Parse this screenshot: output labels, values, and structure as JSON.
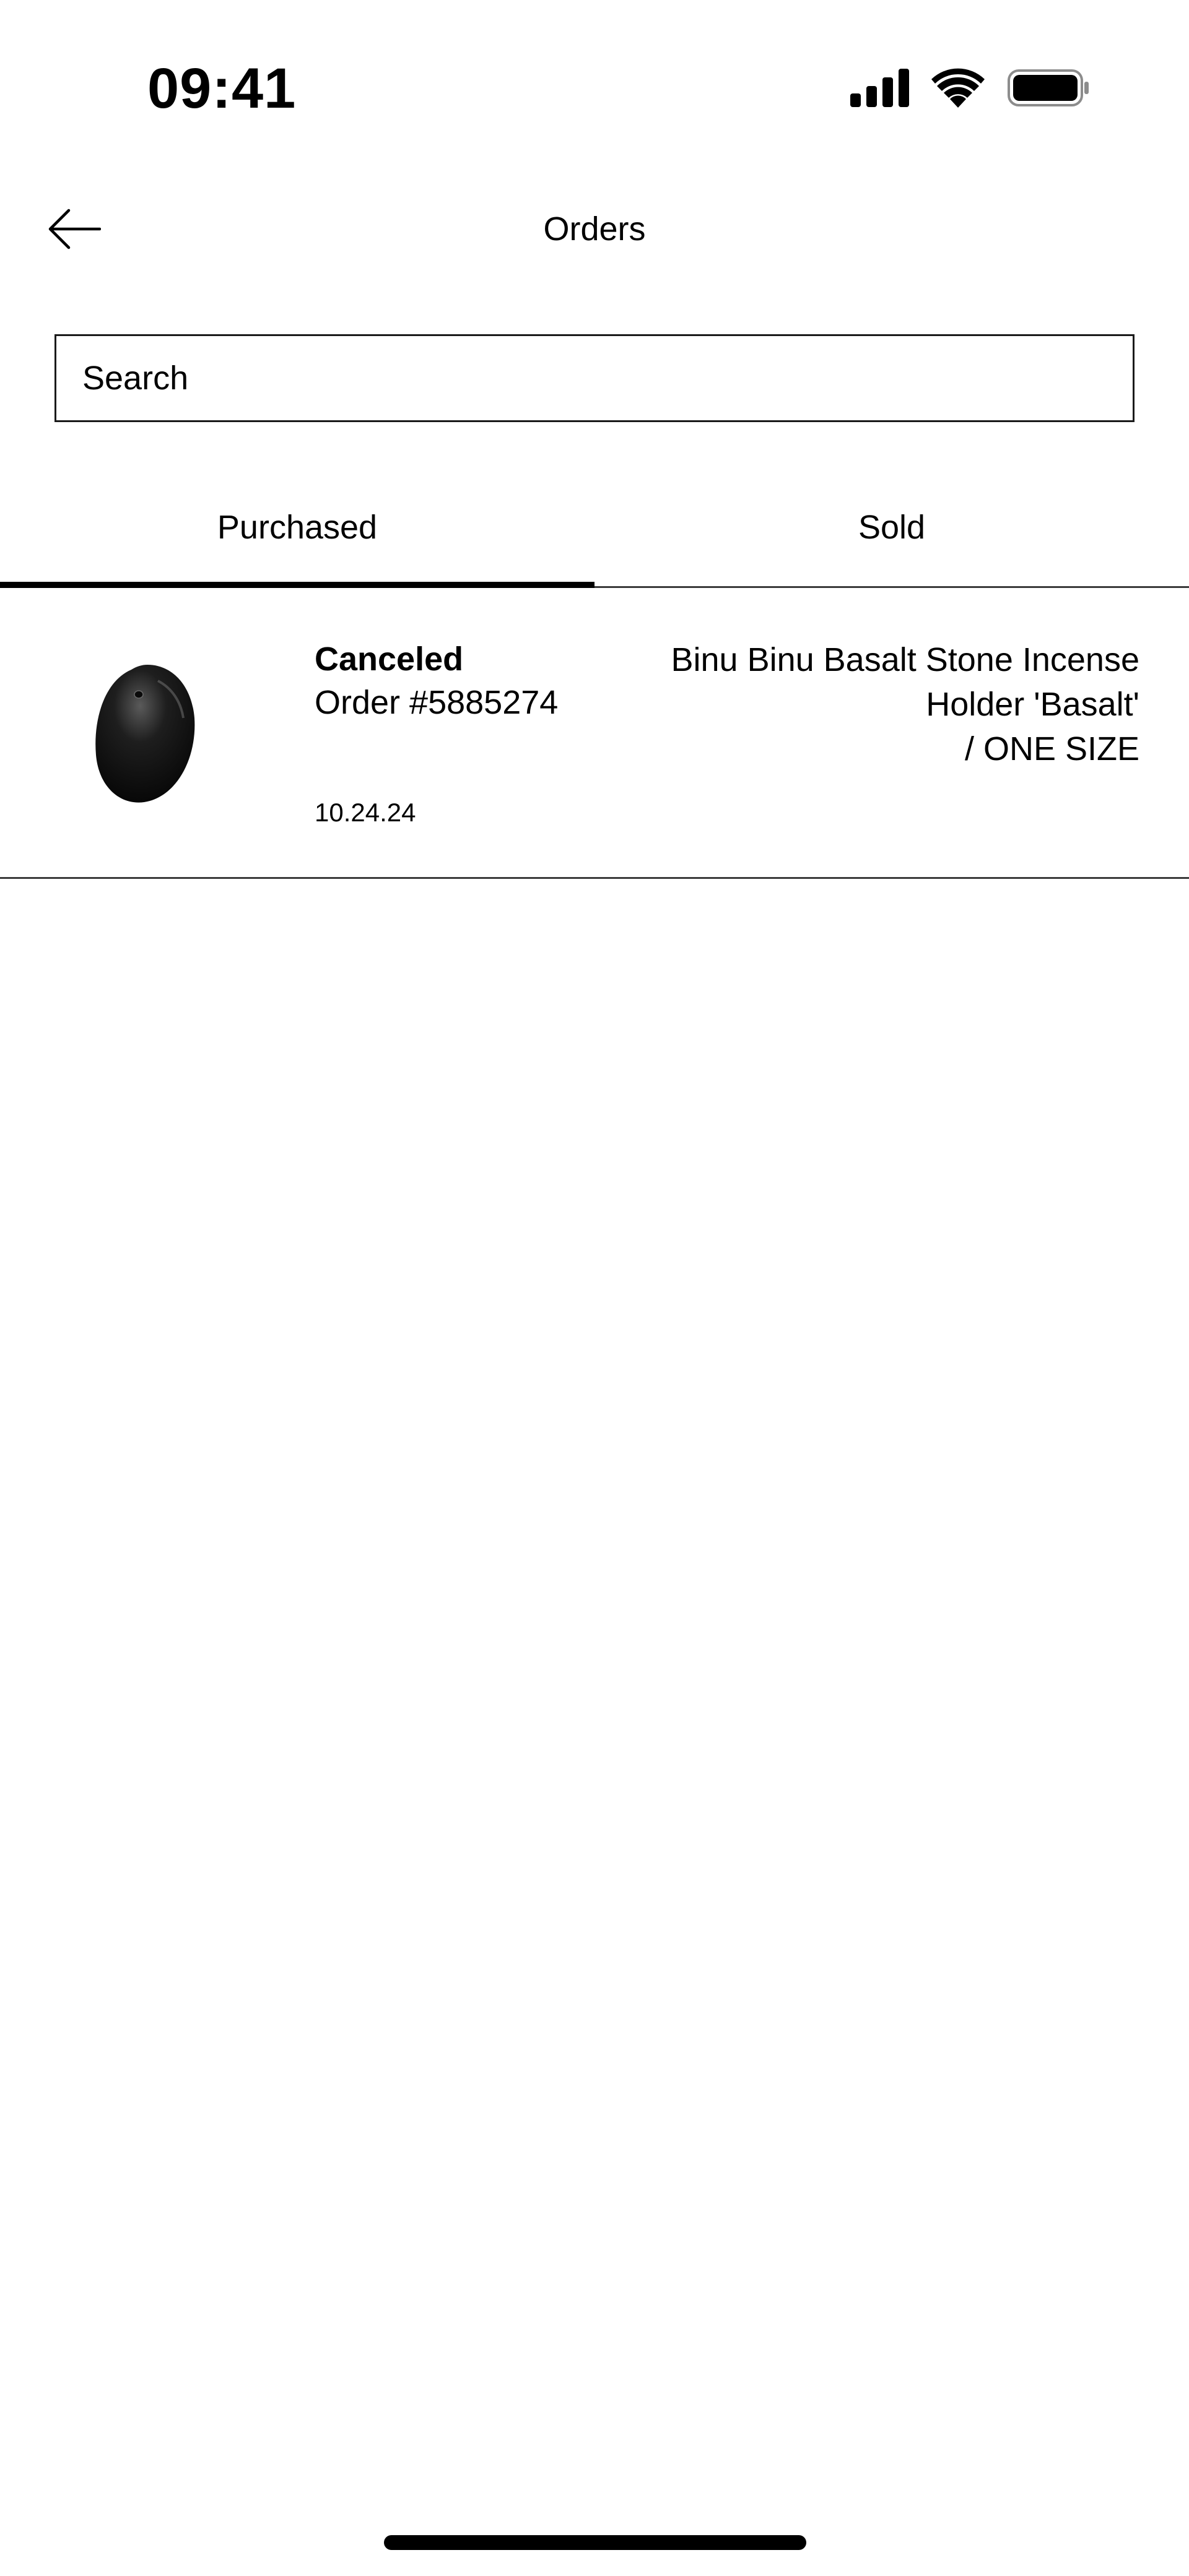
{
  "status_bar": {
    "time": "09:41",
    "icons": [
      "signal-icon",
      "wifi-icon",
      "battery-icon"
    ]
  },
  "nav": {
    "title": "Orders",
    "back_icon": "arrow-left-icon"
  },
  "search": {
    "placeholder": "Search",
    "value": ""
  },
  "tabs": [
    {
      "label": "Purchased",
      "active": true
    },
    {
      "label": "Sold",
      "active": false
    }
  ],
  "orders": [
    {
      "status": "Canceled",
      "order_number": "Order #5885274",
      "date": "10.24.24",
      "product_name": "Binu Binu Basalt Stone Incense Holder 'Basalt'",
      "product_size": "/ ONE SIZE",
      "image": "black-basalt-stone"
    }
  ],
  "colors": {
    "text": "#000000",
    "background": "#ffffff",
    "divider": "#3a3a3a"
  }
}
